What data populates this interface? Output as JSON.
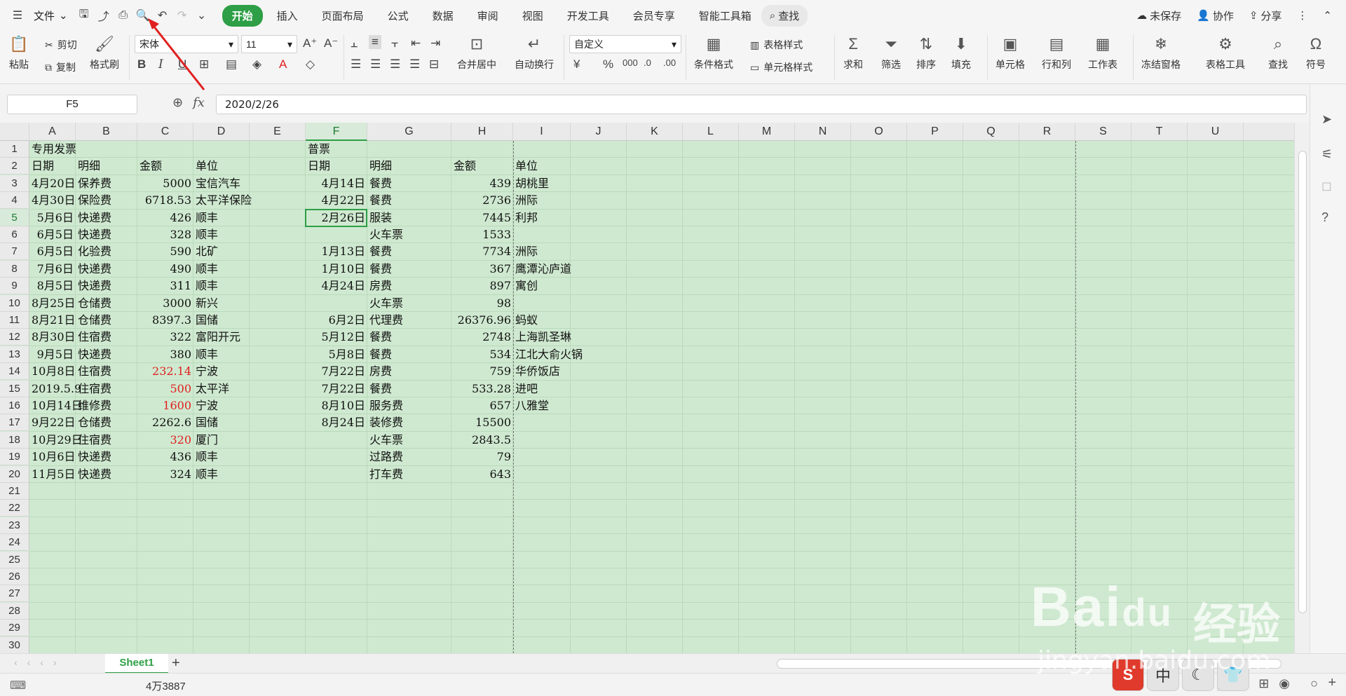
{
  "menubar": {
    "file_label": "文件",
    "tabs": [
      "开始",
      "插入",
      "页面布局",
      "公式",
      "数据",
      "审阅",
      "视图",
      "开发工具",
      "会员专享",
      "智能工具箱"
    ],
    "search_label": "查找",
    "unsaved_label": "未保存",
    "collab_label": "协作",
    "share_label": "分享"
  },
  "ribbon": {
    "paste": "粘贴",
    "cut": "剪切",
    "copy": "复制",
    "format_painter": "格式刷",
    "font_name": "宋体",
    "font_size": "11",
    "merge_center": "合并居中",
    "wrap_text": "自动换行",
    "number_format": "自定义",
    "cond_format": "条件格式",
    "table_style": "表格样式",
    "cell_style": "单元格样式",
    "sum": "求和",
    "filter": "筛选",
    "sort": "排序",
    "fill": "填充",
    "cell": "单元格",
    "rowcol": "行和列",
    "worksheet": "工作表",
    "freeze": "冻结窗格",
    "table_tools": "表格工具",
    "find": "查找",
    "symbol": "符号"
  },
  "formula_bar": {
    "name_box": "F5",
    "fx": "fx",
    "value": "2020/2/26"
  },
  "columns": [
    "A",
    "B",
    "C",
    "D",
    "E",
    "F",
    "G",
    "H",
    "I",
    "J",
    "K",
    "L",
    "M",
    "N",
    "O",
    "P",
    "Q",
    "R",
    "S",
    "T",
    "U"
  ],
  "rows": [
    "1",
    "2",
    "3",
    "4",
    "5",
    "6",
    "7",
    "8",
    "9",
    "10",
    "11",
    "12",
    "13",
    "14",
    "15",
    "16",
    "17",
    "18",
    "19",
    "20",
    "21",
    "22",
    "23",
    "24",
    "25",
    "26",
    "27",
    "28",
    "29",
    "30"
  ],
  "sheet": {
    "r1": {
      "A": "专用发票",
      "F": "普票"
    },
    "r2": {
      "A": "日期",
      "B": "明细",
      "C": "金额",
      "D": "单位",
      "F": "日期",
      "G": "明细",
      "H": "金额",
      "I": "单位"
    },
    "data": [
      {
        "A": "4月20日",
        "B": "保养费",
        "C": "5000",
        "D": "宝信汽车",
        "F": "4月14日",
        "G": "餐费",
        "H": "439",
        "I": "胡桃里"
      },
      {
        "A": "4月30日",
        "B": "保险费",
        "C": "6718.53",
        "D": "太平洋保险",
        "F": "4月22日",
        "G": "餐费",
        "H": "2736",
        "I": "洲际"
      },
      {
        "A": "5月6日",
        "B": "快递费",
        "C": "426",
        "D": "顺丰",
        "F": "2月26日",
        "G": "服装",
        "H": "7445",
        "I": "利邦"
      },
      {
        "A": "6月5日",
        "B": "快递费",
        "C": "328",
        "D": "顺丰",
        "F": "",
        "G": "火车票",
        "H": "1533",
        "I": ""
      },
      {
        "A": "6月5日",
        "B": "化验费",
        "C": "590",
        "D": "北矿",
        "F": "1月13日",
        "G": "餐费",
        "H": "7734",
        "I": "洲际"
      },
      {
        "A": "7月6日",
        "B": "快递费",
        "C": "490",
        "D": "顺丰",
        "F": "1月10日",
        "G": "餐费",
        "H": "367",
        "I": "鹰潭沁庐道"
      },
      {
        "A": "8月5日",
        "B": "快递费",
        "C": "311",
        "D": "顺丰",
        "F": "4月24日",
        "G": "房费",
        "H": "897",
        "I": "寓创"
      },
      {
        "A": "8月25日",
        "B": "仓储费",
        "C": "3000",
        "D": "新兴",
        "F": "",
        "G": "火车票",
        "H": "98",
        "I": ""
      },
      {
        "A": "8月21日",
        "B": "仓储费",
        "C": "8397.3",
        "D": "国储",
        "F": "6月2日",
        "G": "代理费",
        "H": "26376.96",
        "I": "蚂蚁"
      },
      {
        "A": "8月30日",
        "B": "住宿费",
        "C": "322",
        "D": "富阳开元",
        "F": "5月12日",
        "G": "餐费",
        "H": "2748",
        "I": "上海凯圣琳"
      },
      {
        "A": "9月5日",
        "B": "快递费",
        "C": "380",
        "D": "顺丰",
        "F": "5月8日",
        "G": "餐费",
        "H": "534",
        "I": "江北大俞火锅"
      },
      {
        "A": "10月8日",
        "B": "住宿费",
        "C": "232.14",
        "D": "宁波",
        "F": "7月22日",
        "G": "房费",
        "H": "759",
        "I": "华侨饭店",
        "C_red": true
      },
      {
        "A": "2019.5.9",
        "B": "住宿费",
        "C": "500",
        "D": "太平洋",
        "F": "7月22日",
        "G": "餐费",
        "H": "533.28",
        "I": "进吧",
        "C_red": true,
        "A_left": true
      },
      {
        "A": "10月14日",
        "B": "维修费",
        "C": "1600",
        "D": "宁波",
        "F": "8月10日",
        "G": "服务费",
        "H": "657",
        "I": "八雅堂",
        "C_red": true
      },
      {
        "A": "9月22日",
        "B": "仓储费",
        "C": "2262.6",
        "D": "国储",
        "F": "8月24日",
        "G": "装修费",
        "H": "15500",
        "I": ""
      },
      {
        "A": "10月29日",
        "B": "住宿费",
        "C": "320",
        "D": "厦门",
        "F": "",
        "G": "火车票",
        "H": "2843.5",
        "I": "",
        "C_red": true
      },
      {
        "A": "10月6日",
        "B": "快递费",
        "C": "436",
        "D": "顺丰",
        "F": "",
        "G": "过路费",
        "H": "79",
        "I": ""
      },
      {
        "A": "11月5日",
        "B": "快递费",
        "C": "324",
        "D": "顺丰",
        "F": "",
        "G": "打车费",
        "H": "643",
        "I": ""
      }
    ]
  },
  "sheet_tab": "Sheet1",
  "status": {
    "text": "4万3887"
  },
  "ime": {
    "logo": "S",
    "lang": "中"
  },
  "watermark": {
    "big": "Bai",
    "du": "du",
    "cn": "经验",
    "sub": "jingyan.baidu.com"
  },
  "colors": {
    "accent": "#2e9f46",
    "grid_bg": "#cfe9d0",
    "red": "#e02020"
  }
}
